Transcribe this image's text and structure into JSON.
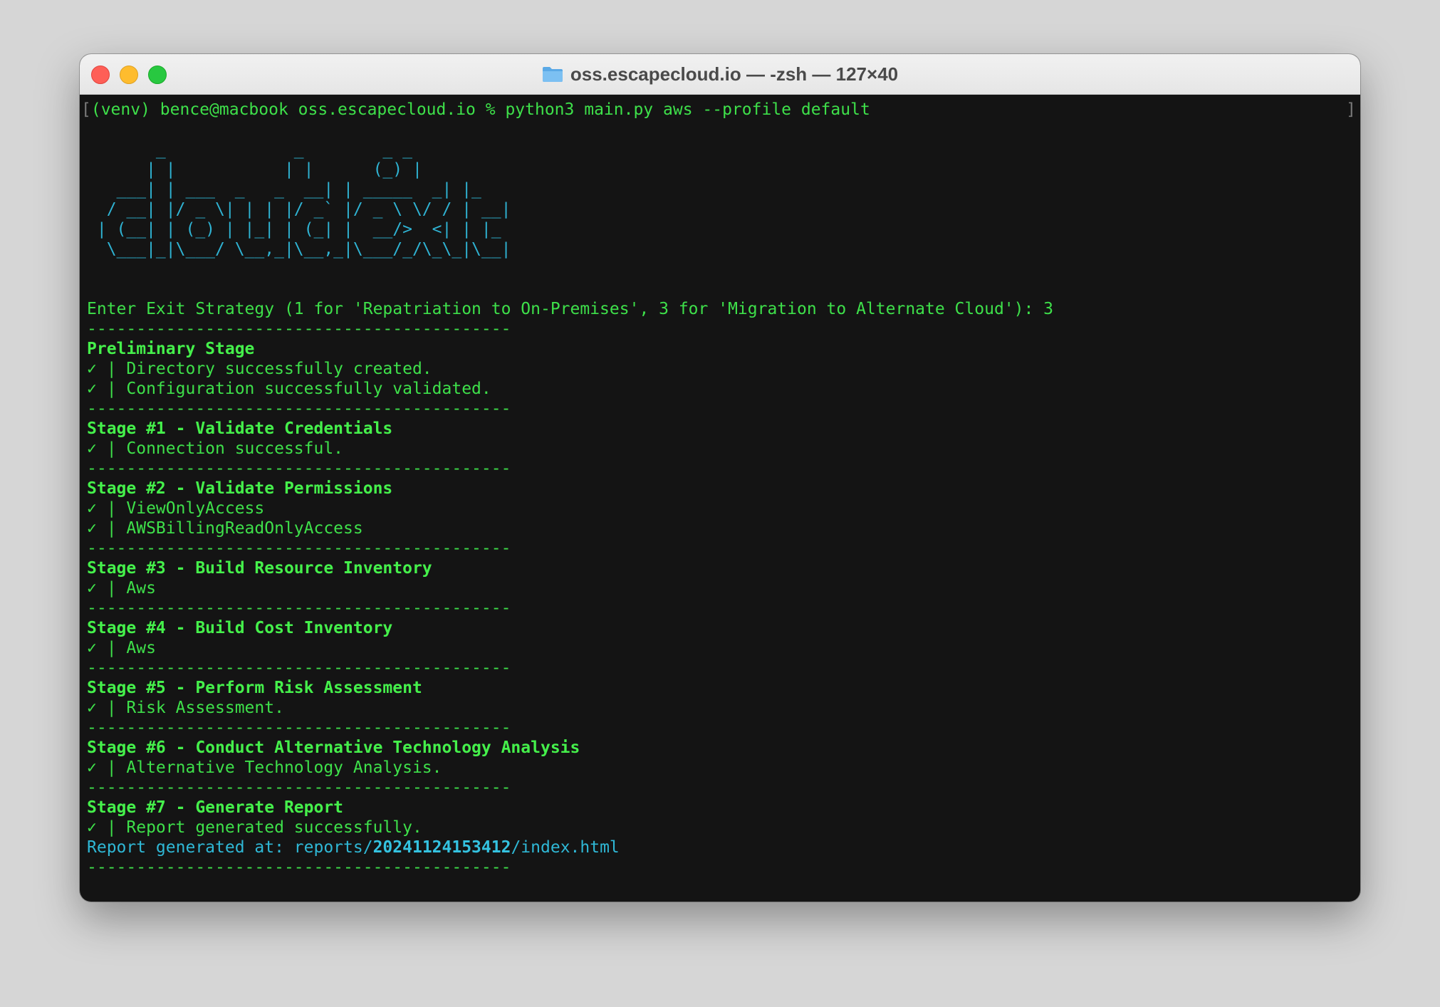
{
  "window": {
    "title": "oss.escapecloud.io — -zsh — 127×40",
    "title_icon": "folder-icon"
  },
  "terminal": {
    "prompt": "(venv) bence@macbook oss.escapecloud.io % python3 main.py aws --profile default",
    "ascii_logo": [
      "       _             _        _ _",
      "      | |           | |      (_) |",
      "   ___| | ___  _   _  __| | _____  _| |_",
      "  / __| |/ _ \\| | | |/ _` |/ _ \\ \\/ / | __|",
      " | (__| | (_) | |_| | (_| |  __/>  <| | |_",
      "  \\___|_|\\___/ \\__,_|\\__,_|\\___/_/\\_\\_|\\__|"
    ],
    "question": "Enter Exit Strategy (1 for 'Repatriation to On-Premises', 3 for 'Migration to Alternate Cloud'): 3",
    "separator": "-------------------------------------------",
    "stages": [
      {
        "title": "Preliminary Stage",
        "items": [
          "✓ | Directory successfully created.",
          "✓ | Configuration successfully validated."
        ]
      },
      {
        "title": "Stage #1 - Validate Credentials",
        "items": [
          "✓ | Connection successful."
        ]
      },
      {
        "title": "Stage #2 - Validate Permissions",
        "items": [
          "✓ | ViewOnlyAccess",
          "✓ | AWSBillingReadOnlyAccess"
        ]
      },
      {
        "title": "Stage #3 - Build Resource Inventory",
        "items": [
          "✓ | Aws"
        ]
      },
      {
        "title": "Stage #4 - Build Cost Inventory",
        "items": [
          "✓ | Aws"
        ]
      },
      {
        "title": "Stage #5 - Perform Risk Assessment",
        "items": [
          "✓ | Risk Assessment."
        ]
      },
      {
        "title": "Stage #6 - Conduct Alternative Technology Analysis",
        "items": [
          "✓ | Alternative Technology Analysis."
        ]
      },
      {
        "title": "Stage #7 - Generate Report",
        "items": [
          "✓ | Report generated successfully."
        ]
      }
    ],
    "report": {
      "prefix": "Report generated at: reports/",
      "id": "20241124153412",
      "suffix": "/index.html"
    }
  },
  "colors": {
    "text_green": "#3ee04a",
    "ascii_cyan": "#2fb3d3",
    "ascii_pink": "#e030c8",
    "background": "#141414"
  }
}
